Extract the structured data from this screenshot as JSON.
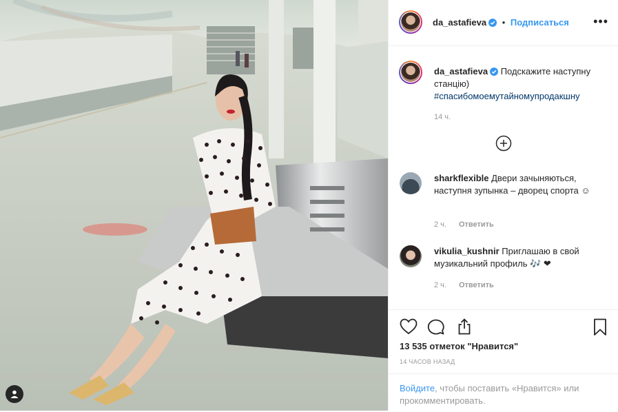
{
  "post": {
    "username": "da_astafieva",
    "follow_label": "Подписаться",
    "caption_text": "Подскажите наступну станцію)",
    "hashtag": "#спасибомоемутайномупродакшну",
    "caption_time": "14 ч.",
    "likes": "13 535 отметок \"Нравится\"",
    "posted_ago": "14 ЧАСОВ НАЗАД"
  },
  "comments": [
    {
      "username": "sharkflexible",
      "text": "Двери зачыняються, наступня зупынка – дворец спорта ☺",
      "time": "2 ч.",
      "reply": "Ответить"
    },
    {
      "username": "vikulia_kushnir",
      "text": "Приглашаю в свой музикальний профиль 🎶 ❤",
      "time": "2 ч.",
      "reply": "Ответить"
    }
  ],
  "footer": {
    "login_link": "Войдите",
    "login_rest": ", чтобы поставить «Нравится» или прокомментировать."
  },
  "icons": {
    "verified": "verified-badge-icon",
    "more": "more-options-icon",
    "load_more": "plus-circle-icon",
    "like": "heart-icon",
    "comment": "comment-icon",
    "share": "share-icon",
    "save": "bookmark-icon",
    "tags": "user-tag-icon"
  },
  "colors": {
    "link": "#3897f0",
    "verified": "#3897f0",
    "hashtag": "#003569"
  }
}
